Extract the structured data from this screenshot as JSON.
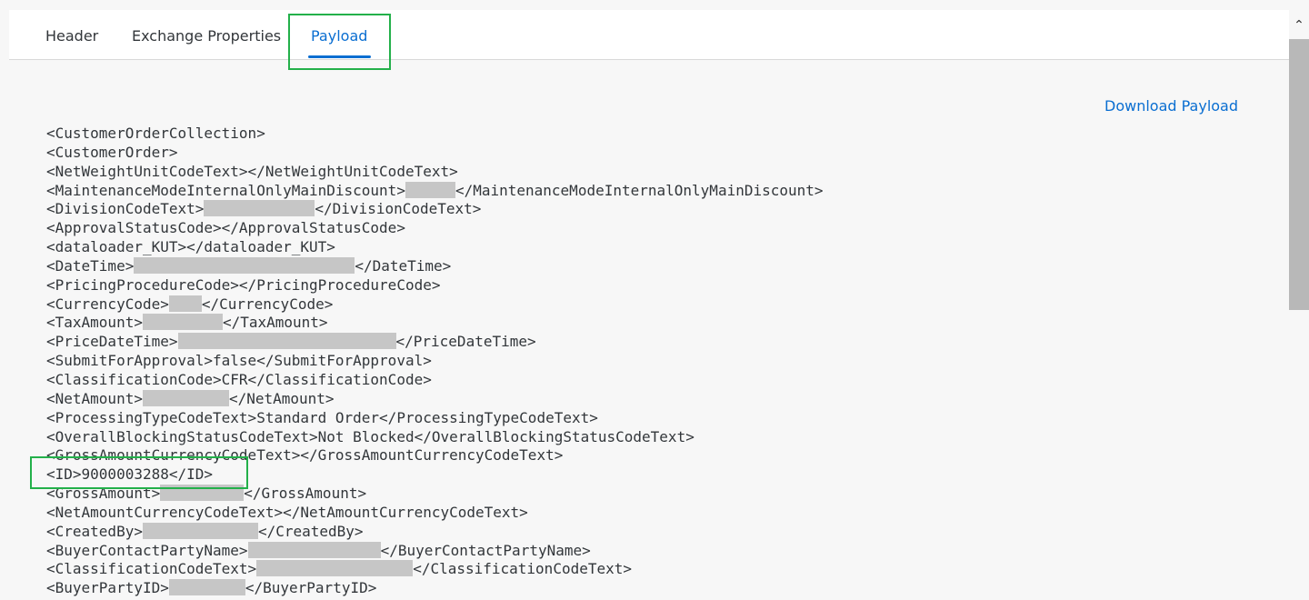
{
  "tabs": [
    {
      "label": "Header"
    },
    {
      "label": "Exchange Properties"
    },
    {
      "label": "Payload"
    }
  ],
  "download_label": "Download Payload",
  "payload_lines": [
    {
      "pre": "<CustomerOrderCollection>",
      "post": ""
    },
    {
      "pre": "<CustomerOrder>",
      "post": ""
    },
    {
      "pre": "<NetWeightUnitCodeText></NetWeightUnitCodeText>",
      "post": ""
    },
    {
      "pre": "<MaintenanceModeInternalOnlyMainDiscount>",
      "post": "</MaintenanceModeInternalOnlyMainDiscount>"
    },
    {
      "pre": "<DivisionCodeText>",
      "post": "</DivisionCodeText>"
    },
    {
      "pre": "<ApprovalStatusCode></ApprovalStatusCode>",
      "post": ""
    },
    {
      "pre": "<dataloader_KUT></dataloader_KUT>",
      "post": ""
    },
    {
      "pre": "<DateTime>",
      "post": "</DateTime>"
    },
    {
      "pre": "<PricingProcedureCode></PricingProcedureCode>",
      "post": ""
    },
    {
      "pre": "<CurrencyCode>",
      "post": "</CurrencyCode>"
    },
    {
      "pre": "<TaxAmount>",
      "post": "</TaxAmount>"
    },
    {
      "pre": "<PriceDateTime>",
      "post": "</PriceDateTime>"
    },
    {
      "pre": "<SubmitForApproval>false</SubmitForApproval>",
      "post": ""
    },
    {
      "pre": "<ClassificationCode>CFR</ClassificationCode>",
      "post": ""
    },
    {
      "pre": "<NetAmount>",
      "post": "</NetAmount>"
    },
    {
      "pre": "<ProcessingTypeCodeText>Standard Order</ProcessingTypeCodeText>",
      "post": ""
    },
    {
      "pre": "<OverallBlockingStatusCodeText>Not Blocked</OverallBlockingStatusCodeText>",
      "post": ""
    },
    {
      "pre": "<GrossAmountCurrencyCodeText></GrossAmountCurrencyCodeText>",
      "post": ""
    },
    {
      "pre": "<ID>9000003288</ID>",
      "post": ""
    },
    {
      "pre": "<GrossAmount>",
      "post": "</GrossAmount>"
    },
    {
      "pre": "<NetAmountCurrencyCodeText></NetAmountCurrencyCodeText>",
      "post": ""
    },
    {
      "pre": "<CreatedBy>",
      "post": "</CreatedBy>"
    },
    {
      "pre": "<BuyerContactPartyName>",
      "post": "</BuyerContactPartyName>"
    },
    {
      "pre": "<ClassificationCodeText>",
      "post": "</ClassificationCodeText>"
    },
    {
      "pre": "<BuyerPartyID>",
      "post": "</BuyerPartyID>"
    }
  ]
}
